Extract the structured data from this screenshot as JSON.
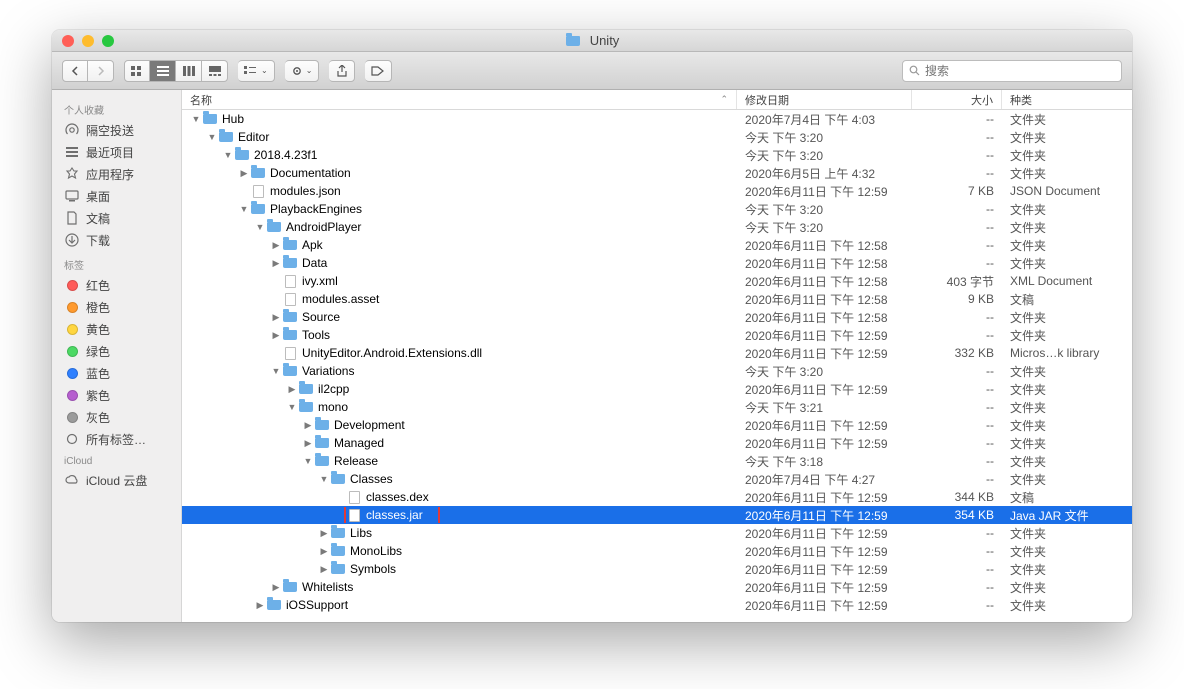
{
  "window": {
    "title": "Unity"
  },
  "toolbar": {
    "search_placeholder": "搜索"
  },
  "sidebar": {
    "sections": [
      {
        "header": "个人收藏",
        "items": [
          {
            "icon": "airdrop",
            "label": "隔空投送"
          },
          {
            "icon": "recents",
            "label": "最近项目"
          },
          {
            "icon": "apps",
            "label": "应用程序"
          },
          {
            "icon": "desktop",
            "label": "桌面"
          },
          {
            "icon": "documents",
            "label": "文稿"
          },
          {
            "icon": "downloads",
            "label": "下载"
          }
        ]
      },
      {
        "header": "标签",
        "items": [
          {
            "icon": "dot",
            "color": "#ff5b59",
            "label": "红色"
          },
          {
            "icon": "dot",
            "color": "#ff9a2e",
            "label": "橙色"
          },
          {
            "icon": "dot",
            "color": "#ffd640",
            "label": "黄色"
          },
          {
            "icon": "dot",
            "color": "#4cd964",
            "label": "绿色"
          },
          {
            "icon": "dot",
            "color": "#2f80ff",
            "label": "蓝色"
          },
          {
            "icon": "dot",
            "color": "#b65fcf",
            "label": "紫色"
          },
          {
            "icon": "dot",
            "color": "#9b9b9b",
            "label": "灰色"
          },
          {
            "icon": "tags",
            "label": "所有标签…"
          }
        ]
      },
      {
        "header": "iCloud",
        "items": [
          {
            "icon": "cloud",
            "label": "iCloud 云盘"
          }
        ]
      }
    ]
  },
  "columns": {
    "name": "名称",
    "date": "修改日期",
    "size": "大小",
    "kind": "种类"
  },
  "rows": [
    {
      "indent": 0,
      "arrow": "down",
      "type": "folder",
      "name": "Hub",
      "date": "2020年7月4日 下午 4:03",
      "size": "--",
      "kind": "文件夹"
    },
    {
      "indent": 1,
      "arrow": "down",
      "type": "folder",
      "name": "Editor",
      "date": "今天 下午 3:20",
      "size": "--",
      "kind": "文件夹"
    },
    {
      "indent": 2,
      "arrow": "down",
      "type": "folder",
      "name": "2018.4.23f1",
      "date": "今天 下午 3:20",
      "size": "--",
      "kind": "文件夹"
    },
    {
      "indent": 3,
      "arrow": "right",
      "type": "folder",
      "name": "Documentation",
      "date": "2020年6月5日 上午 4:32",
      "size": "--",
      "kind": "文件夹"
    },
    {
      "indent": 3,
      "arrow": "",
      "type": "file",
      "name": "modules.json",
      "date": "2020年6月11日 下午 12:59",
      "size": "7 KB",
      "kind": "JSON Document"
    },
    {
      "indent": 3,
      "arrow": "down",
      "type": "folder",
      "name": "PlaybackEngines",
      "date": "今天 下午 3:20",
      "size": "--",
      "kind": "文件夹"
    },
    {
      "indent": 4,
      "arrow": "down",
      "type": "folder",
      "name": "AndroidPlayer",
      "date": "今天 下午 3:20",
      "size": "--",
      "kind": "文件夹"
    },
    {
      "indent": 5,
      "arrow": "right",
      "type": "folder",
      "name": "Apk",
      "date": "2020年6月11日 下午 12:58",
      "size": "--",
      "kind": "文件夹"
    },
    {
      "indent": 5,
      "arrow": "right",
      "type": "folder",
      "name": "Data",
      "date": "2020年6月11日 下午 12:58",
      "size": "--",
      "kind": "文件夹"
    },
    {
      "indent": 5,
      "arrow": "",
      "type": "file",
      "name": "ivy.xml",
      "date": "2020年6月11日 下午 12:58",
      "size": "403 字节",
      "kind": "XML Document"
    },
    {
      "indent": 5,
      "arrow": "",
      "type": "file",
      "name": "modules.asset",
      "date": "2020年6月11日 下午 12:58",
      "size": "9 KB",
      "kind": "文稿"
    },
    {
      "indent": 5,
      "arrow": "right",
      "type": "folder",
      "name": "Source",
      "date": "2020年6月11日 下午 12:58",
      "size": "--",
      "kind": "文件夹"
    },
    {
      "indent": 5,
      "arrow": "right",
      "type": "folder",
      "name": "Tools",
      "date": "2020年6月11日 下午 12:59",
      "size": "--",
      "kind": "文件夹"
    },
    {
      "indent": 5,
      "arrow": "",
      "type": "file",
      "name": "UnityEditor.Android.Extensions.dll",
      "date": "2020年6月11日 下午 12:59",
      "size": "332 KB",
      "kind": "Micros…k library"
    },
    {
      "indent": 5,
      "arrow": "down",
      "type": "folder",
      "name": "Variations",
      "date": "今天 下午 3:20",
      "size": "--",
      "kind": "文件夹"
    },
    {
      "indent": 6,
      "arrow": "right",
      "type": "folder",
      "name": "il2cpp",
      "date": "2020年6月11日 下午 12:59",
      "size": "--",
      "kind": "文件夹"
    },
    {
      "indent": 6,
      "arrow": "down",
      "type": "folder",
      "name": "mono",
      "date": "今天 下午 3:21",
      "size": "--",
      "kind": "文件夹"
    },
    {
      "indent": 7,
      "arrow": "right",
      "type": "folder",
      "name": "Development",
      "date": "2020年6月11日 下午 12:59",
      "size": "--",
      "kind": "文件夹"
    },
    {
      "indent": 7,
      "arrow": "right",
      "type": "folder",
      "name": "Managed",
      "date": "2020年6月11日 下午 12:59",
      "size": "--",
      "kind": "文件夹"
    },
    {
      "indent": 7,
      "arrow": "down",
      "type": "folder",
      "name": "Release",
      "date": "今天 下午 3:18",
      "size": "--",
      "kind": "文件夹"
    },
    {
      "indent": 8,
      "arrow": "down",
      "type": "folder",
      "name": "Classes",
      "date": "2020年7月4日 下午 4:27",
      "size": "--",
      "kind": "文件夹"
    },
    {
      "indent": 9,
      "arrow": "",
      "type": "file",
      "name": "classes.dex",
      "date": "2020年6月11日 下午 12:59",
      "size": "344 KB",
      "kind": "文稿"
    },
    {
      "indent": 9,
      "arrow": "",
      "type": "file",
      "name": "classes.jar",
      "date": "2020年6月11日 下午 12:59",
      "size": "354 KB",
      "kind": "Java JAR 文件",
      "selected": true,
      "highlighted": true
    },
    {
      "indent": 8,
      "arrow": "right",
      "type": "folder",
      "name": "Libs",
      "date": "2020年6月11日 下午 12:59",
      "size": "--",
      "kind": "文件夹"
    },
    {
      "indent": 8,
      "arrow": "right",
      "type": "folder",
      "name": "MonoLibs",
      "date": "2020年6月11日 下午 12:59",
      "size": "--",
      "kind": "文件夹"
    },
    {
      "indent": 8,
      "arrow": "right",
      "type": "folder",
      "name": "Symbols",
      "date": "2020年6月11日 下午 12:59",
      "size": "--",
      "kind": "文件夹"
    },
    {
      "indent": 5,
      "arrow": "right",
      "type": "folder",
      "name": "Whitelists",
      "date": "2020年6月11日 下午 12:59",
      "size": "--",
      "kind": "文件夹"
    },
    {
      "indent": 4,
      "arrow": "right",
      "type": "folder",
      "name": "iOSSupport",
      "date": "2020年6月11日 下午 12:59",
      "size": "--",
      "kind": "文件夹"
    }
  ]
}
